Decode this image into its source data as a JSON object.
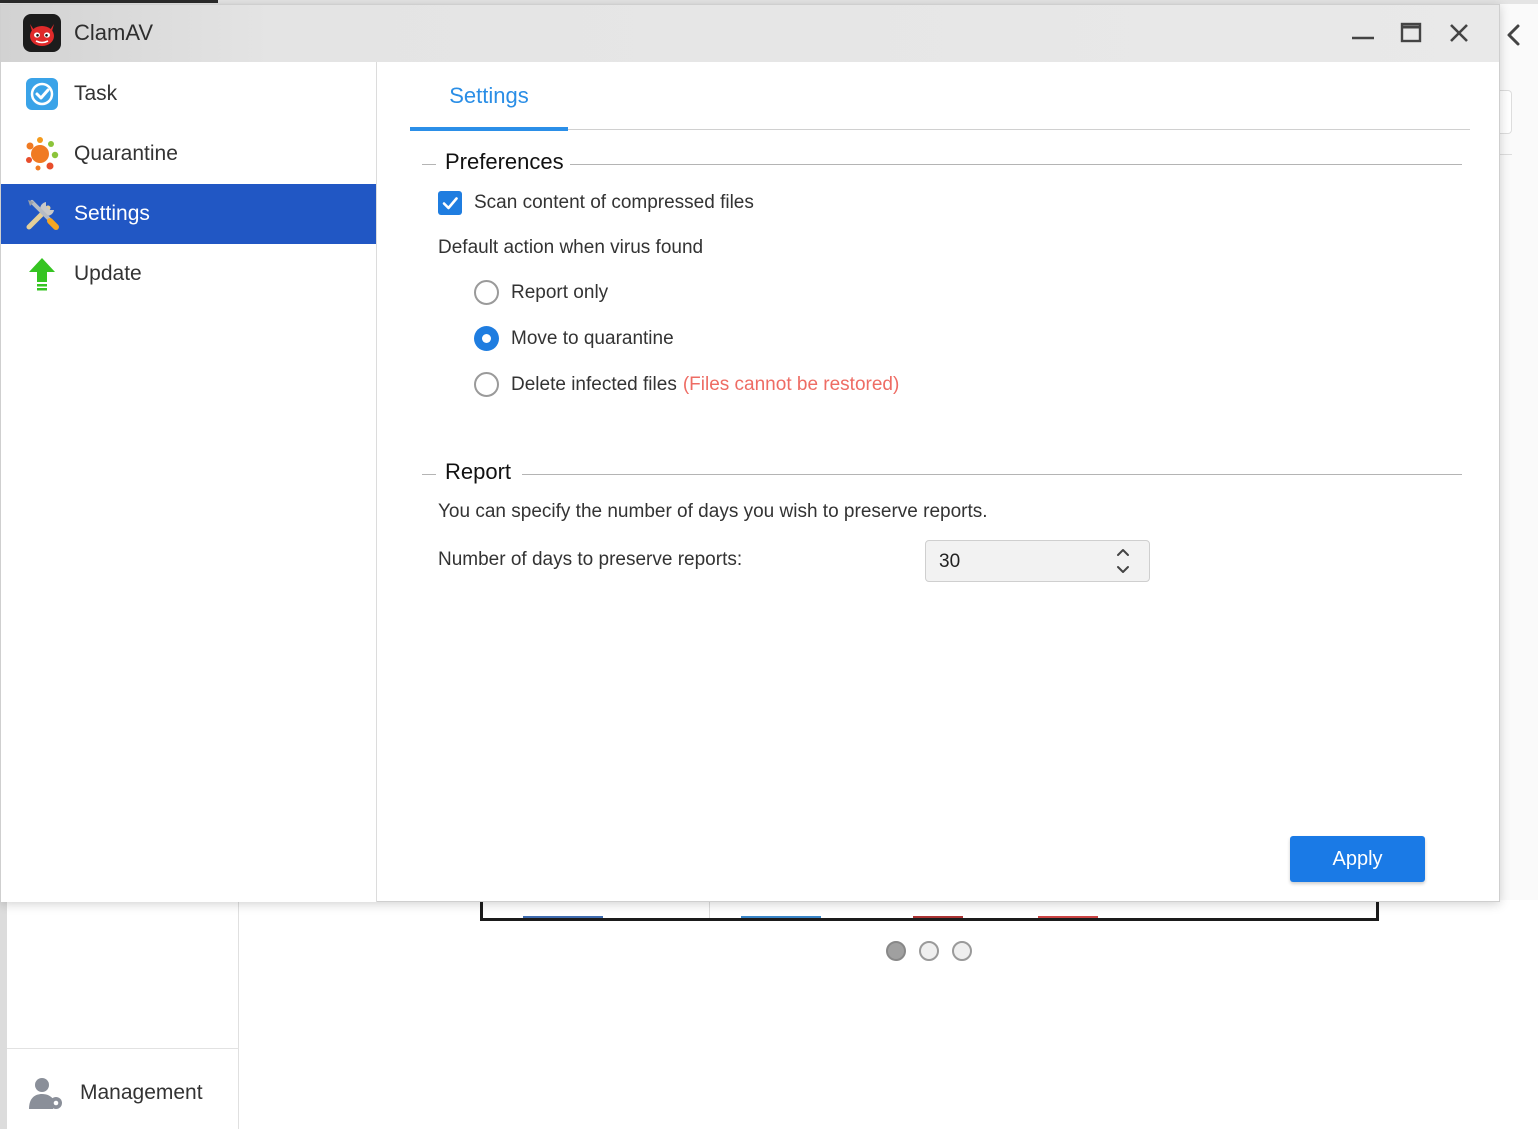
{
  "window": {
    "title": "ClamAV"
  },
  "sidebar": {
    "items": [
      {
        "label": "Task",
        "icon": "task-check-icon"
      },
      {
        "label": "Quarantine",
        "icon": "quarantine-splat-icon"
      },
      {
        "label": "Settings",
        "icon": "tools-icon",
        "active": true
      },
      {
        "label": "Update",
        "icon": "update-arrow-icon"
      }
    ]
  },
  "tabs": [
    {
      "label": "Settings",
      "active": true
    }
  ],
  "preferences": {
    "title": "Preferences",
    "scan_compressed": {
      "label": "Scan content of compressed files",
      "checked": true
    },
    "default_action_label": "Default action when virus found",
    "options": [
      {
        "label": "Report only",
        "checked": false
      },
      {
        "label": "Move to quarantine",
        "checked": true
      },
      {
        "label": "Delete infected files",
        "warning": "(Files cannot be restored)",
        "checked": false
      }
    ]
  },
  "report": {
    "title": "Report",
    "description": "You can specify the number of days you wish to preserve reports.",
    "days_label": "Number of days to preserve reports:",
    "days_value": "30"
  },
  "apply_label": "Apply",
  "background": {
    "management_label": "Management"
  },
  "colors": {
    "accent": "#1a7ae6",
    "sidebar_active": "#2157c4",
    "tab_active": "#2b8fe8",
    "warning": "#ee6c64"
  }
}
